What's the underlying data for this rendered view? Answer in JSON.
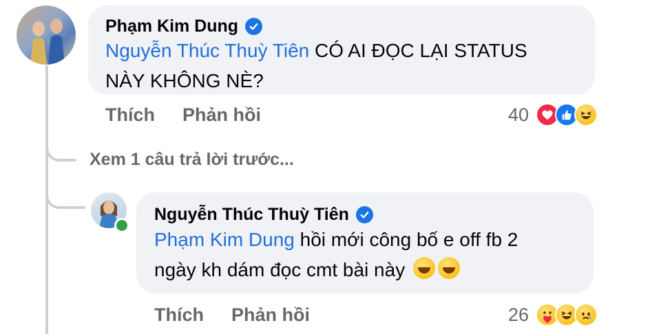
{
  "comment": {
    "author": "Phạm Kim Dung",
    "mention": "Nguyễn Thúc Thuỳ Tiên",
    "text_line1": " CÓ AI ĐỌC LẠI STATUS",
    "text_line2": "NÀY KHÔNG NÈ?",
    "like_label": "Thích",
    "reply_label": "Phản hồi",
    "reaction_count": "40",
    "reactions": [
      "love-icon",
      "like-icon",
      "haha-icon"
    ]
  },
  "see_previous_replies": "Xem 1 câu trả lời trước...",
  "reply": {
    "author": "Nguyễn Thúc Thuỳ Tiên",
    "mention": "Phạm Kim Dung",
    "text_line1": "  hồi mới công bố e off fb 2",
    "text_line2": "ngày kh dám đọc cmt bài này",
    "like_label": "Thích",
    "reply_label": "Phản hồi",
    "reaction_count": "26",
    "reactions": [
      "care-icon",
      "haha-icon",
      "sad-icon"
    ],
    "online": true
  },
  "colors": {
    "mention": "#216fdb",
    "bubble": "#f0f2f5",
    "secondary_text": "#65676b",
    "verified": "#1b74e4",
    "online": "#31a24c"
  }
}
